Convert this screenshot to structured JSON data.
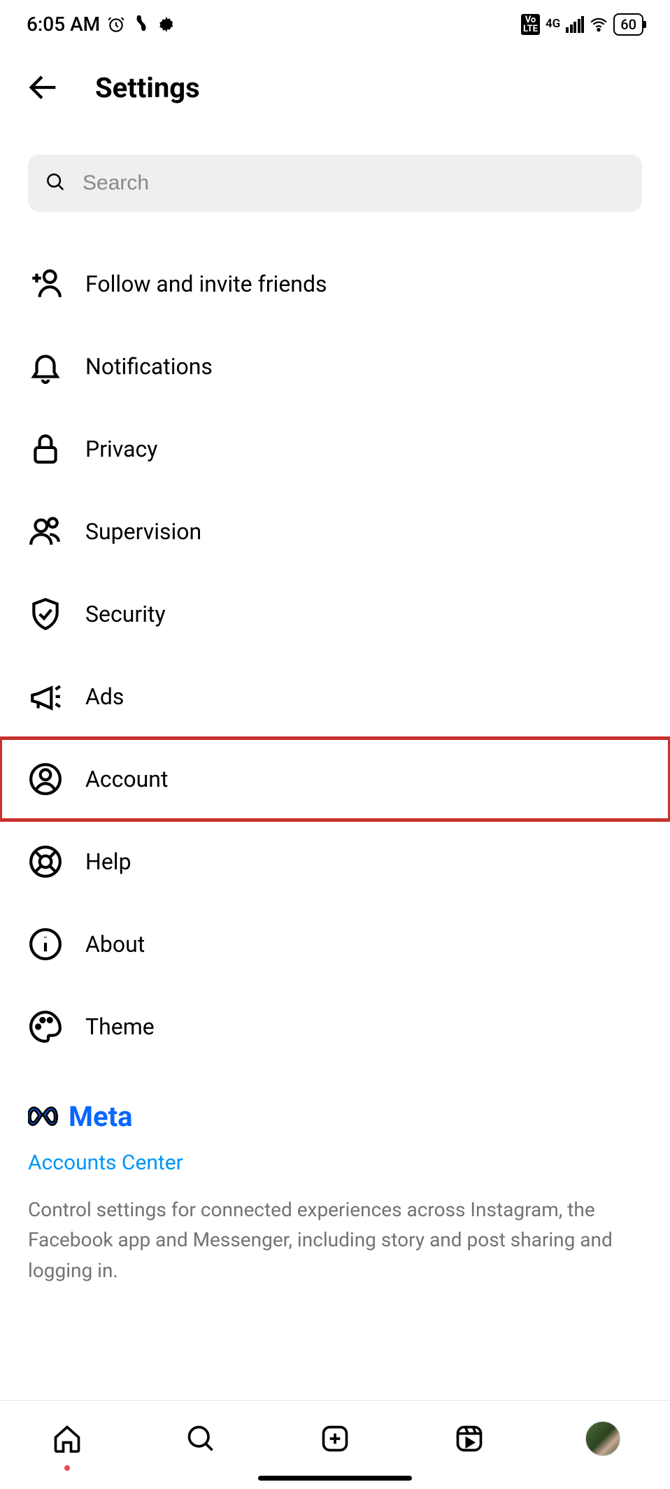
{
  "status_bar": {
    "time": "6:05 AM",
    "network_label": "4G",
    "volte_label": "Vo\nLTE",
    "battery": "60"
  },
  "header": {
    "title": "Settings"
  },
  "search": {
    "placeholder": "Search"
  },
  "menu_items": [
    {
      "id": "follow-invite",
      "label": "Follow and invite friends",
      "icon": "add-person-icon",
      "highlighted": false
    },
    {
      "id": "notifications",
      "label": "Notifications",
      "icon": "bell-icon",
      "highlighted": false
    },
    {
      "id": "privacy",
      "label": "Privacy",
      "icon": "lock-icon",
      "highlighted": false
    },
    {
      "id": "supervision",
      "label": "Supervision",
      "icon": "people-icon",
      "highlighted": false
    },
    {
      "id": "security",
      "label": "Security",
      "icon": "shield-check-icon",
      "highlighted": false
    },
    {
      "id": "ads",
      "label": "Ads",
      "icon": "megaphone-icon",
      "highlighted": false
    },
    {
      "id": "account",
      "label": "Account",
      "icon": "profile-circle-icon",
      "highlighted": true
    },
    {
      "id": "help",
      "label": "Help",
      "icon": "lifebuoy-icon",
      "highlighted": false
    },
    {
      "id": "about",
      "label": "About",
      "icon": "info-icon",
      "highlighted": false
    },
    {
      "id": "theme",
      "label": "Theme",
      "icon": "palette-icon",
      "highlighted": false
    }
  ],
  "meta": {
    "brand": "Meta",
    "accounts_center_label": "Accounts Center",
    "description": "Control settings for connected experiences across Instagram, the Facebook app and Messenger, including story and post sharing and logging in."
  },
  "highlight_color": "#c9302c",
  "accent_color": "#0095f6"
}
